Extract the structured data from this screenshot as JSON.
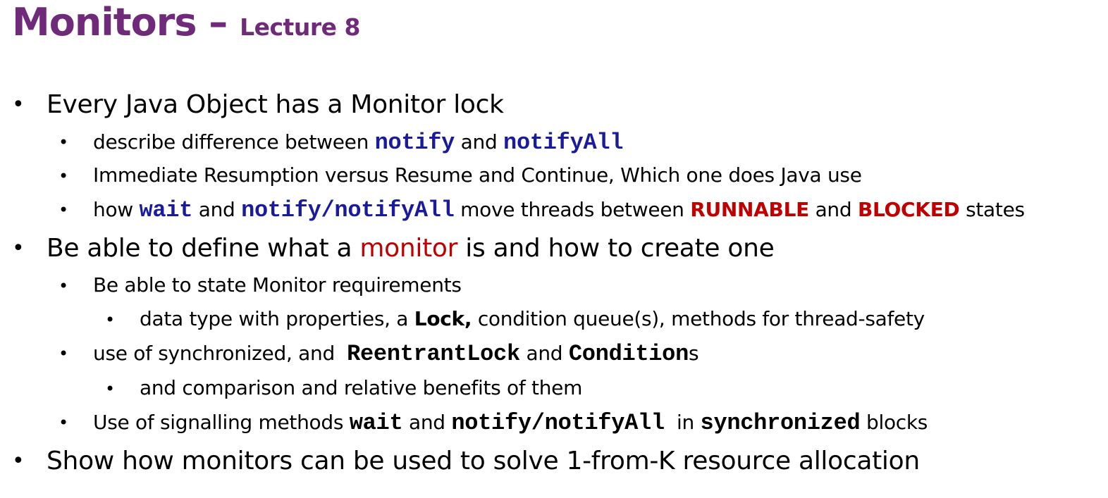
{
  "title": {
    "main": "Monitors – ",
    "sub": "Lecture 8"
  },
  "bullets": {
    "b1": {
      "text": "Every Java Object has a Monitor lock",
      "s1": {
        "pre": "describe difference between ",
        "code1": "notify",
        "mid": " and ",
        "code2": "notifyAll"
      },
      "s2": {
        "text": "Immediate Resumption versus Resume and Continue, Which one does Java use"
      },
      "s3": {
        "pre": "how ",
        "code1": "wait",
        "mid1": " and ",
        "code2": "notify",
        "slash": "/",
        "code3": "notifyAll",
        "mid2": " move threads between ",
        "state1": "RUNNABLE",
        "mid3": " and ",
        "state2": "BLOCKED",
        "post": " states"
      }
    },
    "b2": {
      "pre": "Be able to define what a ",
      "accent": "monitor",
      "post": " is and how to create one",
      "s1": {
        "text": "Be able to state Monitor requirements",
        "ss1": {
          "pre": "data type with properties, a ",
          "strong": "Lock,",
          "post": " condition queue(s), methods for thread-safety"
        }
      },
      "s2": {
        "pre": "use of synchronized, and  ",
        "code1": "ReentrantLock",
        "mid": " and ",
        "code2": "Condition",
        "post": "s",
        "ss1": {
          "text": "and comparison and relative benefits of them"
        }
      },
      "s3": {
        "pre": "Use of signalling methods ",
        "code1": "wait",
        "mid1": " and ",
        "code2": "notify",
        "slash": "/",
        "code3": "notifyAll",
        "mid2": "  in ",
        "code4": "synchronized",
        "post": " blocks"
      }
    },
    "b3": {
      "text": "Show how monitors can be used to solve 1-from-K resource allocation"
    }
  },
  "colors": {
    "title": "#6f2a7a",
    "code_blue": "#1a1a9c",
    "state_red": "#c00000",
    "accent_red": "#c00000"
  }
}
